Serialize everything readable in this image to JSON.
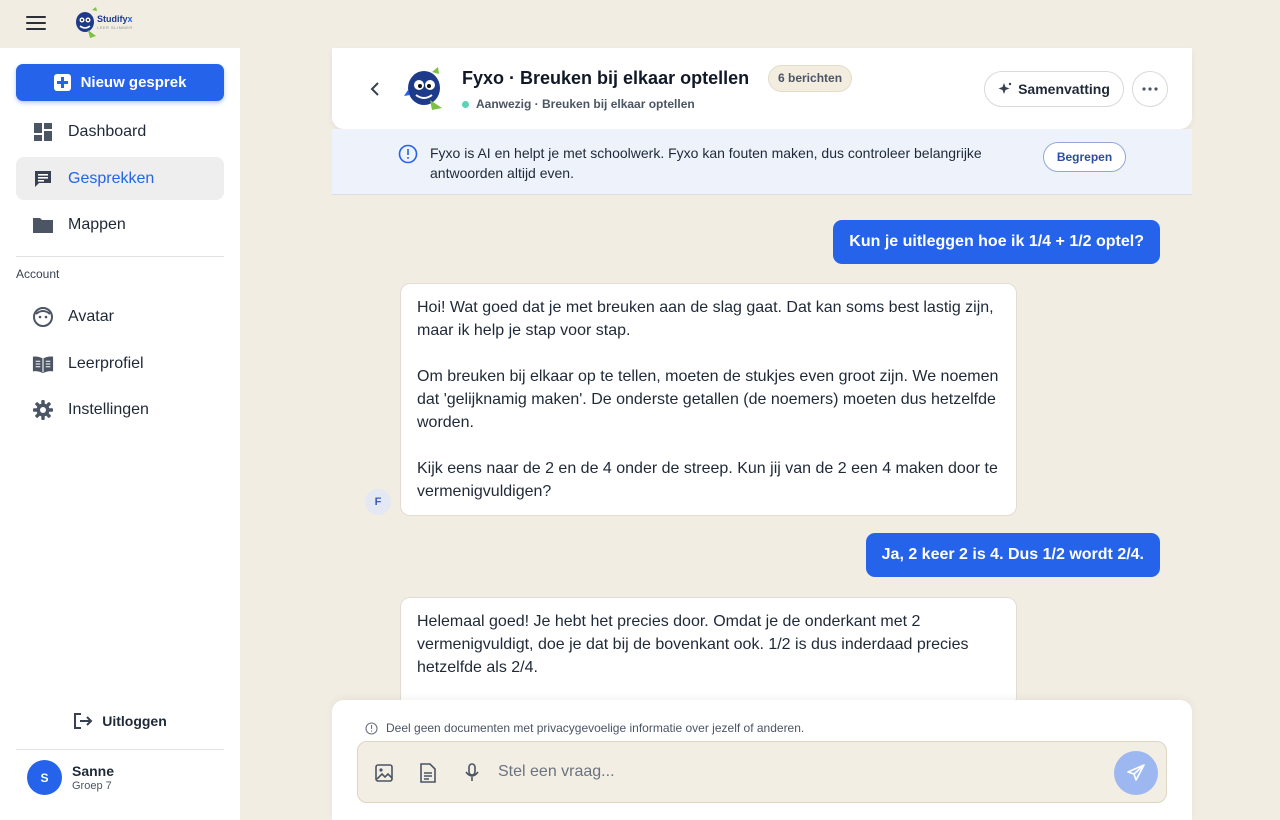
{
  "app": {
    "logo_brand": "Studify",
    "logo_brand_accent": "x",
    "logo_tagline": "LEER SLIMMER"
  },
  "sidebar": {
    "new_chat_label": "Nieuw gesprek",
    "items": [
      {
        "label": "Dashboard",
        "icon": "dashboard-icon"
      },
      {
        "label": "Gesprekken",
        "icon": "chat-icon",
        "active": true
      },
      {
        "label": "Mappen",
        "icon": "folder-icon"
      }
    ],
    "account_label": "Account",
    "account_items": [
      {
        "label": "Avatar",
        "icon": "face-icon"
      },
      {
        "label": "Leerprofiel",
        "icon": "book-icon"
      },
      {
        "label": "Instellingen",
        "icon": "gear-icon"
      }
    ],
    "logout_label": "Uitloggen",
    "user": {
      "initial": "S",
      "name": "Sanne",
      "group": "Groep 7"
    }
  },
  "chat": {
    "title": "Fyxo · Breuken bij elkaar optellen",
    "message_count": "6 berichten",
    "presence": "Aanwezig · Breuken bij elkaar optellen",
    "presence_color": "#5ad4b6",
    "summary_label": "Samenvatting",
    "notice": "Fyxo is AI en helpt je met schoolwerk. Fyxo kan fouten maken, dus controleer belangrijke antwoorden altijd even.",
    "notice_button": "Begrepen",
    "bot_initial": "F",
    "messages": [
      {
        "role": "user",
        "text": "Kun je uitleggen hoe ik 1/4 + 1/2 optel?"
      },
      {
        "role": "bot",
        "paragraphs": [
          "Hoi! Wat goed dat je met breuken aan de slag gaat. Dat kan soms best lastig zijn, maar ik help je stap voor stap.",
          "Om breuken bij elkaar op te tellen, moeten de stukjes even groot zijn. We noemen dat 'gelijknamig maken'. De onderste getallen (de noemers) moeten dus hetzelfde worden.",
          "Kijk eens naar de 2 en de 4 onder de streep. Kun jij van de 2 een 4 maken door te vermenigvuldigen?"
        ]
      },
      {
        "role": "user",
        "text": "Ja, 2 keer 2 is 4. Dus 1/2 wordt 2/4."
      },
      {
        "role": "bot",
        "paragraphs": [
          "Helemaal goed! Je hebt het precies door. Omdat je de onderkant met 2 vermenigvuldigt, doe je dat bij de bovenkant ook. 1/2 is dus inderdaad precies hetzelfde als 2/4."
        ]
      }
    ]
  },
  "composer": {
    "privacy_notice": "Deel geen documenten met privacygevoelige informatie over jezelf of anderen.",
    "placeholder": "Stel een vraag...",
    "value": ""
  },
  "colors": {
    "accent": "#2563eb",
    "background": "#f1ede3",
    "send_button": "#9db8f0"
  }
}
